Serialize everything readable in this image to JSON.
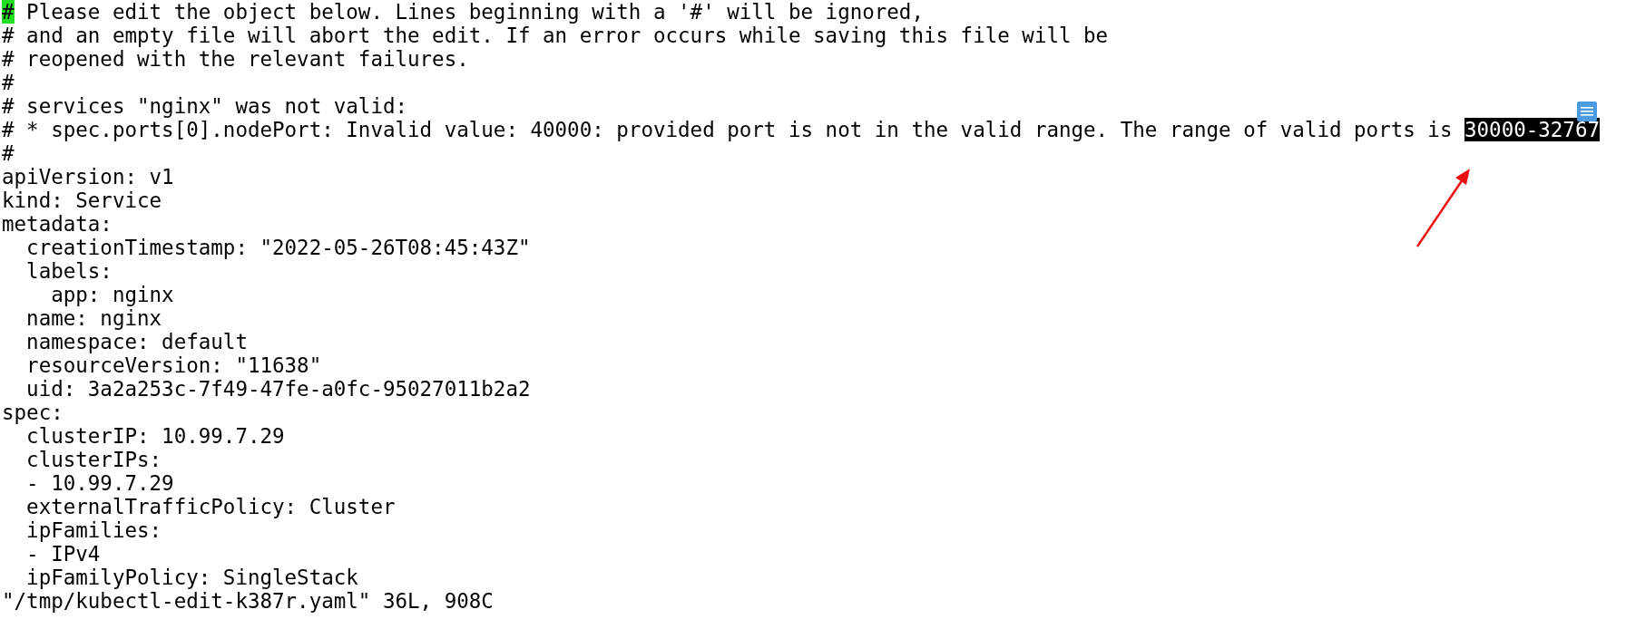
{
  "editor": {
    "lines": [
      {
        "cursor": "#",
        "text": " Please edit the object below. Lines beginning with a '#' will be ignored,"
      },
      {
        "text": "# and an empty file will abort the edit. If an error occurs while saving this file will be"
      },
      {
        "text": "# reopened with the relevant failures."
      },
      {
        "text": "#"
      },
      {
        "text": "# services \"nginx\" was not valid:"
      },
      {
        "text": "# * spec.ports[0].nodePort: Invalid value: 40000: provided port is not in the valid range. The range of valid ports is ",
        "selection": "30000-32767"
      },
      {
        "text": "#"
      },
      {
        "text": "apiVersion: v1"
      },
      {
        "text": "kind: Service"
      },
      {
        "text": "metadata:"
      },
      {
        "text": "  creationTimestamp: \"2022-05-26T08:45:43Z\""
      },
      {
        "text": "  labels:"
      },
      {
        "text": "    app: nginx"
      },
      {
        "text": "  name: nginx"
      },
      {
        "text": "  namespace: default"
      },
      {
        "text": "  resourceVersion: \"11638\""
      },
      {
        "text": "  uid: 3a2a253c-7f49-47fe-a0fc-95027011b2a2"
      },
      {
        "text": "spec:"
      },
      {
        "text": "  clusterIP: 10.99.7.29"
      },
      {
        "text": "  clusterIPs:"
      },
      {
        "text": "  - 10.99.7.29"
      },
      {
        "text": "  externalTrafficPolicy: Cluster"
      },
      {
        "text": "  ipFamilies:"
      },
      {
        "text": "  - IPv4"
      },
      {
        "text": "  ipFamilyPolicy: SingleStack"
      }
    ],
    "status_line": "\"/tmp/kubectl-edit-k387r.yaml\" 36L, 908C"
  }
}
